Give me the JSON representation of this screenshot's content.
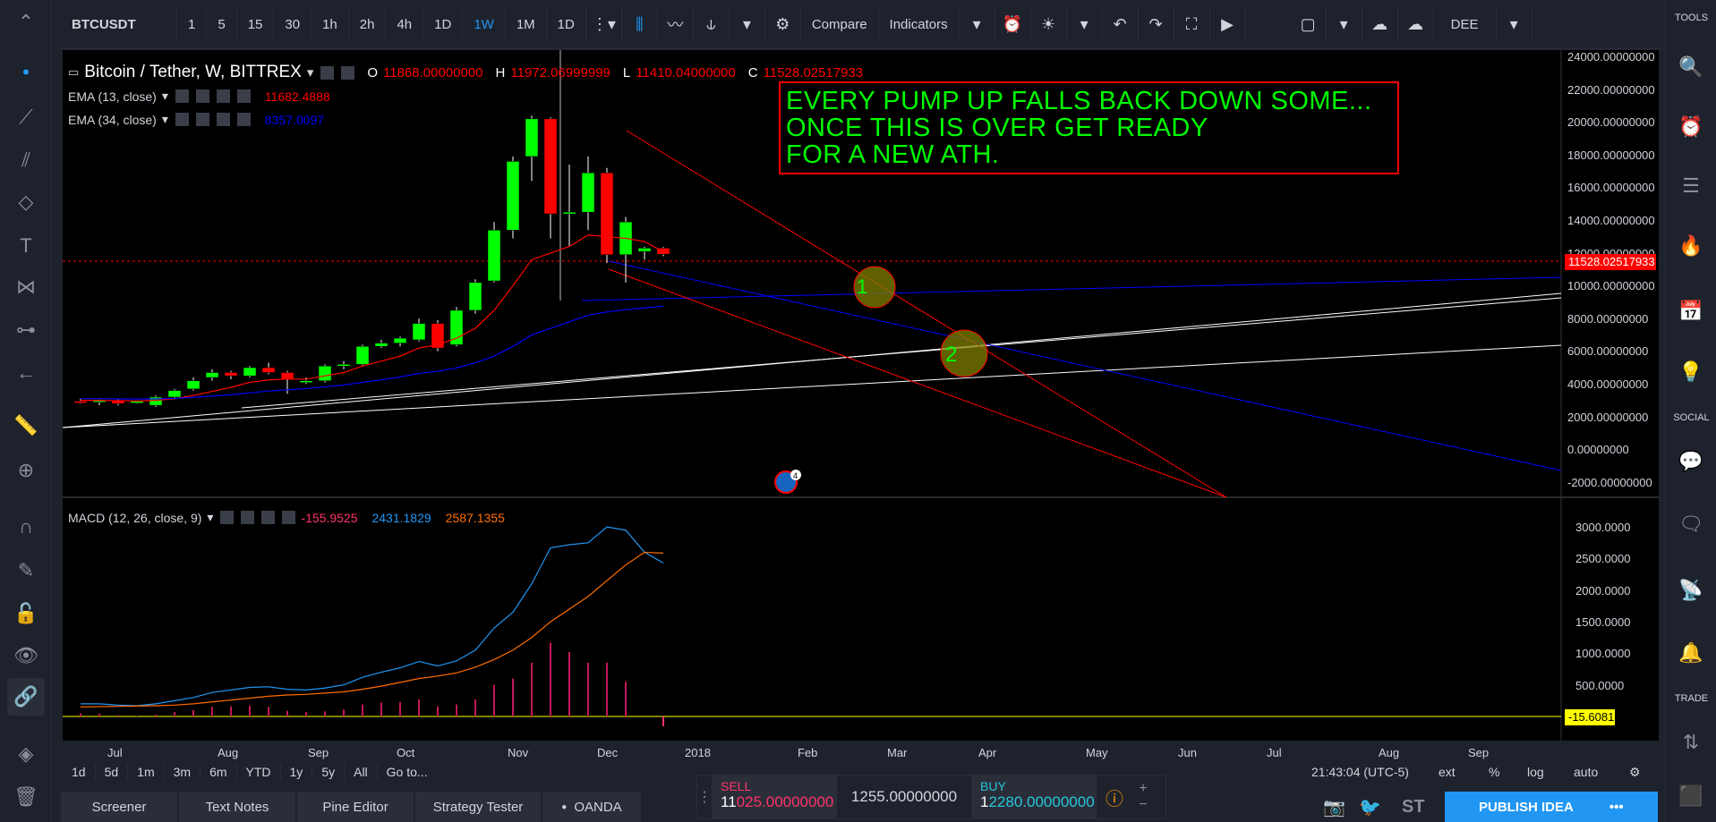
{
  "toolbar": {
    "symbol": "BTCUSDT",
    "intervals": [
      "1",
      "5",
      "15",
      "30",
      "1h",
      "2h",
      "4h",
      "1D",
      "1W",
      "1M",
      "1D"
    ],
    "active_interval": "1W",
    "compare": "Compare",
    "indicators": "Indicators",
    "account": "DEE"
  },
  "legend": {
    "title": "Bitcoin / Tether, W, BITTREX",
    "o_label": "O",
    "o": "11868.00000000",
    "h_label": "H",
    "h": "11972.06999999",
    "l_label": "L",
    "l": "11410.04000000",
    "c_label": "C",
    "c": "11528.02517933",
    "ema13_label": "EMA (13, close)",
    "ema13": "11682.4888",
    "ema34_label": "EMA (34, close)",
    "ema34": "8357.0097",
    "macd_label": "MACD (12, 26, close, 9)",
    "macd_hist": "-155.9525",
    "macd_line": "2431.1829",
    "macd_signal": "2587.1355"
  },
  "annotation": {
    "line1": "EVERY PUMP UP FALLS BACK DOWN SOME...",
    "line2": "ONCE THIS IS OVER GET READY",
    "line3": "FOR A NEW ATH."
  },
  "markers": {
    "m1": "1",
    "m2": "2",
    "badge": "4"
  },
  "price_axis": [
    "24000.00000000",
    "22000.00000000",
    "20000.00000000",
    "18000.00000000",
    "16000.00000000",
    "14000.00000000",
    "12000.00000000",
    "10000.00000000",
    "8000.00000000",
    "6000.00000000",
    "4000.00000000",
    "2000.00000000",
    "0.00000000",
    "-2000.00000000"
  ],
  "current_price_tag": "11528.02517933",
  "macd_axis": [
    "3000.0000",
    "2500.0000",
    "2000.0000",
    "1500.0000",
    "1000.0000",
    "500.0000"
  ],
  "macd_tag": "-15.6081",
  "time_axis": [
    "Jul",
    "Aug",
    "Sep",
    "Oct",
    "Nov",
    "Dec",
    "2018",
    "Feb",
    "Mar",
    "Apr",
    "May",
    "Jun",
    "Jul",
    "Aug",
    "Sep"
  ],
  "ranges": [
    "1d",
    "5d",
    "1m",
    "3m",
    "6m",
    "YTD",
    "1y",
    "5y",
    "All",
    "Go to..."
  ],
  "status": {
    "time": "21:43:04 (UTC-5)",
    "ext": "ext",
    "pct": "%",
    "log": "log",
    "auto": "auto"
  },
  "tabs": [
    "Screener",
    "Text Notes",
    "Pine Editor",
    "Strategy Tester",
    "OANDA"
  ],
  "trade": {
    "sell_label": "SELL",
    "sell_big": "11",
    "sell_rest": "025.00000000",
    "spread": "1255.00000000",
    "buy_label": "BUY",
    "buy_big": "1",
    "buy_rest": "2280.00000000"
  },
  "publish": "PUBLISH IDEA",
  "right_labels": {
    "tools": "TOOLS",
    "social": "SOCIAL",
    "trade": "TRADE"
  },
  "colors": {
    "up": "#00ff00",
    "down": "#ff0000",
    "accent": "#2196f3"
  }
}
